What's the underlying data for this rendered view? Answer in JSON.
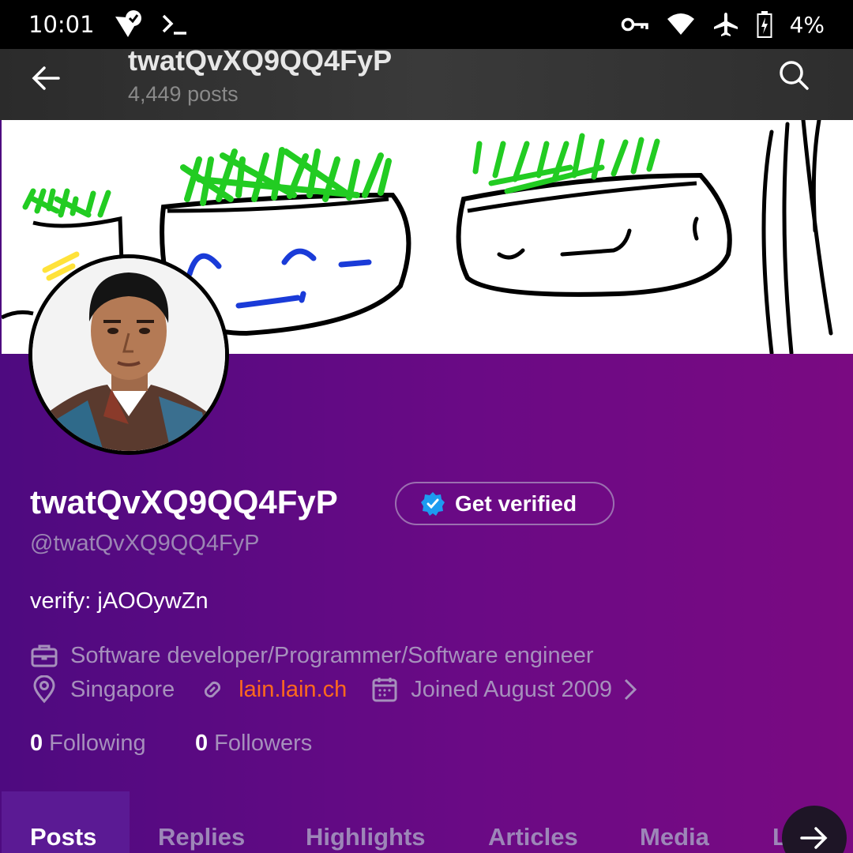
{
  "status_bar": {
    "time": "10:01",
    "battery": "4%",
    "icons": [
      "check-badge-icon",
      "terminal-icon",
      "key-icon",
      "wifi-icon",
      "airplane-icon",
      "battery-icon"
    ]
  },
  "header": {
    "title": "twatQvXQ9QQ4FyP",
    "post_count": "4,449 posts",
    "back_icon": "arrow-left-icon",
    "search_icon": "search-icon"
  },
  "profile": {
    "display_name": "twatQvXQ9QQ4FyP",
    "verify_button": "Get verified",
    "handle": "@twatQvXQ9QQ4FyP",
    "bio": "verify: jAOOywZn",
    "profession": "Software developer/Programmer/Software engineer",
    "location": "Singapore",
    "website": "lain.lain.ch",
    "joined": "Joined August 2009",
    "following_count": "0",
    "following_label": "Following",
    "followers_count": "0",
    "followers_label": "Followers"
  },
  "tabs": [
    "Posts",
    "Replies",
    "Highlights",
    "Articles",
    "Media",
    "L"
  ],
  "colors": {
    "background_start": "#4e0a80",
    "background_end": "#7a0a82",
    "link": "#ff6a1c",
    "verified_badge": "#1d9bf0"
  }
}
